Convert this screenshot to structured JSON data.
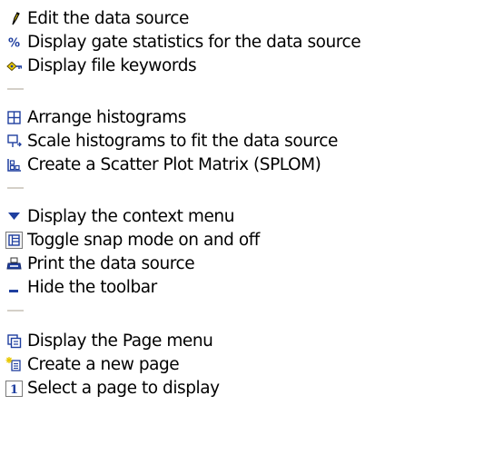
{
  "groups": [
    {
      "items": [
        {
          "icon": "pencil-icon",
          "label": "Edit the data source"
        },
        {
          "icon": "percent-icon",
          "label": "Display gate statistics for the data source"
        },
        {
          "icon": "keywords-icon",
          "label": "Display file keywords"
        }
      ]
    },
    {
      "items": [
        {
          "icon": "arrange-grid-icon",
          "label": "Arrange histograms"
        },
        {
          "icon": "scale-histogram-icon",
          "label": "Scale histograms to fit the data source"
        },
        {
          "icon": "splom-icon",
          "label": "Create a Scatter Plot Matrix (SPLOM)"
        }
      ]
    },
    {
      "items": [
        {
          "icon": "triangle-down-icon",
          "label": "Display the context menu"
        },
        {
          "icon": "snap-grid-icon",
          "label": "Toggle snap mode on and off"
        },
        {
          "icon": "printer-icon",
          "label": "Print the data source"
        },
        {
          "icon": "hide-toolbar-icon",
          "label": "Hide the toolbar"
        }
      ]
    },
    {
      "items": [
        {
          "icon": "page-menu-icon",
          "label": "Display the Page menu"
        },
        {
          "icon": "new-page-icon",
          "label": "Create a new page"
        },
        {
          "icon": "page-number-icon",
          "label": "Select a page to display",
          "icon_text": "1"
        }
      ]
    }
  ],
  "colors": {
    "separator": "#d4d0c8",
    "text": "#000000",
    "accent_blue": "#1f3f9f",
    "pencil_yellow": "#e8c800"
  }
}
